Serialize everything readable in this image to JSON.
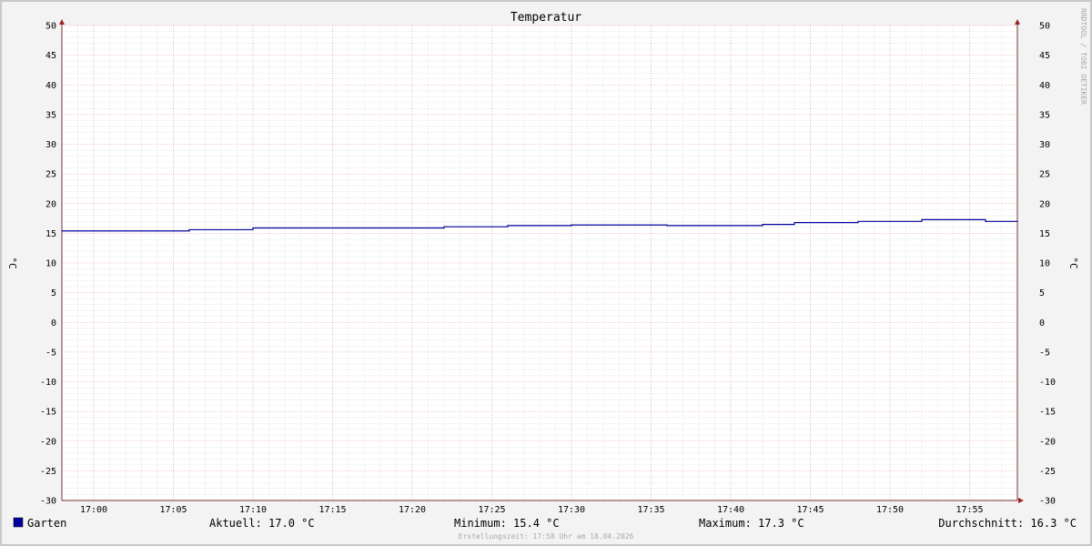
{
  "chart_data": {
    "type": "line",
    "title": "Temperatur",
    "ylabel_left": "°C",
    "ylabel_right": "°C",
    "watermark": "RRDTOOL / TOBI OETIKER",
    "ylim": [
      -30,
      50
    ],
    "y_ticks": [
      50,
      45,
      40,
      35,
      30,
      25,
      20,
      15,
      10,
      5,
      0,
      -5,
      -10,
      -15,
      -20,
      -25,
      -30
    ],
    "x_ticks": [
      "17:00",
      "17:05",
      "17:10",
      "17:15",
      "17:20",
      "17:25",
      "17:30",
      "17:35",
      "17:40",
      "17:45",
      "17:50",
      "17:55"
    ],
    "grid": true,
    "legend_position": "bottom",
    "series": [
      {
        "name": "Garten",
        "color": "#0000a0",
        "x": [
          "16:58",
          "17:06",
          "17:10",
          "17:22",
          "17:26",
          "17:30",
          "17:36",
          "17:42",
          "17:44",
          "17:48",
          "17:52",
          "17:56",
          "17:58"
        ],
        "y": [
          15.4,
          15.6,
          15.9,
          16.1,
          16.3,
          16.4,
          16.3,
          16.5,
          16.8,
          17.0,
          17.3,
          17.0,
          17.0
        ]
      }
    ],
    "stats": {
      "aktuell": "Aktuell: 17.0 °C",
      "minimum": "Minimum: 15.4 °C",
      "maximum": "Maximum: 17.3 °C",
      "durchschnitt": "Durchschnitt: 16.3 °C"
    },
    "footer": "Erstellungszeit: 17:58 Uhr am 18.04.2026"
  }
}
